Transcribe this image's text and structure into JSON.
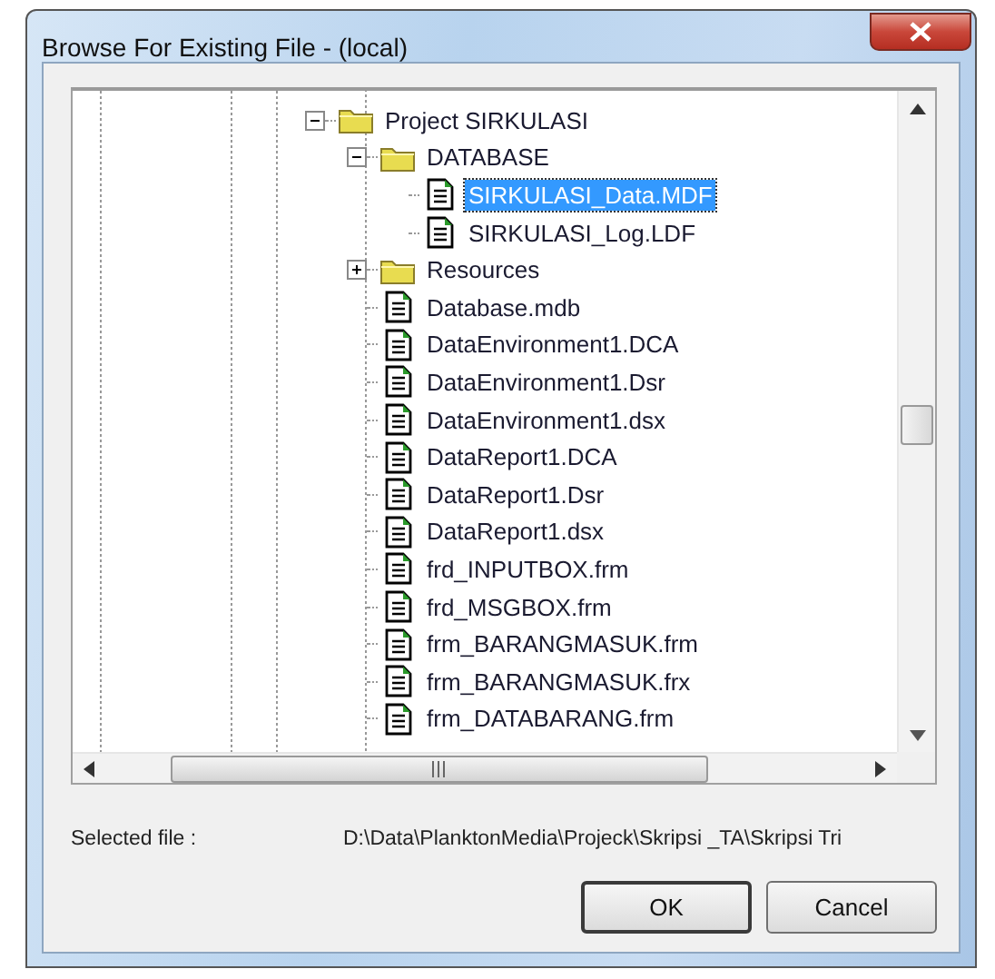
{
  "window": {
    "title": "Browse For Existing File - (local)"
  },
  "tree": [
    {
      "kind": "folder",
      "label": "Project SIRKULASI",
      "expanded": true,
      "selected": false,
      "children": [
        {
          "kind": "folder",
          "label": "DATABASE",
          "expanded": true,
          "selected": false,
          "children": [
            {
              "kind": "file",
              "label": "SIRKULASI_Data.MDF",
              "selected": true
            },
            {
              "kind": "file",
              "label": "SIRKULASI_Log.LDF",
              "selected": false
            }
          ]
        },
        {
          "kind": "folder",
          "label": "Resources",
          "expanded": false,
          "selected": false
        },
        {
          "kind": "file",
          "label": "Database.mdb",
          "selected": false
        },
        {
          "kind": "file",
          "label": "DataEnvironment1.DCA",
          "selected": false
        },
        {
          "kind": "file",
          "label": "DataEnvironment1.Dsr",
          "selected": false
        },
        {
          "kind": "file",
          "label": "DataEnvironment1.dsx",
          "selected": false
        },
        {
          "kind": "file",
          "label": "DataReport1.DCA",
          "selected": false
        },
        {
          "kind": "file",
          "label": "DataReport1.Dsr",
          "selected": false
        },
        {
          "kind": "file",
          "label": "DataReport1.dsx",
          "selected": false
        },
        {
          "kind": "file",
          "label": "frd_INPUTBOX.frm",
          "selected": false
        },
        {
          "kind": "file",
          "label": "frd_MSGBOX.frm",
          "selected": false
        },
        {
          "kind": "file",
          "label": "frm_BARANGMASUK.frm",
          "selected": false
        },
        {
          "kind": "file",
          "label": "frm_BARANGMASUK.frx",
          "selected": false
        },
        {
          "kind": "file",
          "label": "frm_DATABARANG.frm",
          "selected": false
        }
      ]
    }
  ],
  "selected_file": {
    "label": "Selected file :",
    "value": "D:\\Data\\PlanktonMedia\\Projeck\\Skripsi _TA\\Skripsi Tri"
  },
  "buttons": [
    {
      "label": "OK",
      "default": true
    },
    {
      "label": "Cancel",
      "default": false
    }
  ]
}
